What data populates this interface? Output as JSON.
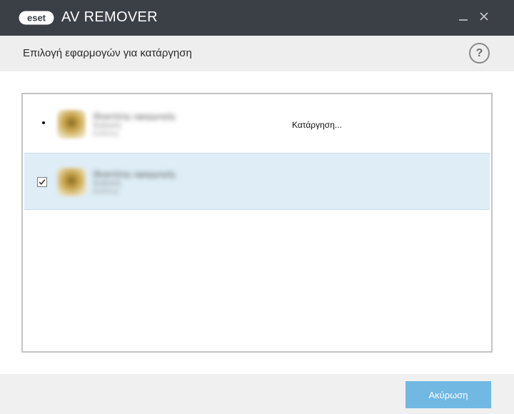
{
  "window": {
    "logo_text": "ESET",
    "app_title": "AV REMOVER",
    "minimize_glyph": "_",
    "close_glyph": "×",
    "colors": {
      "titlebar": "#3b3f46",
      "accent": "#71b8e3",
      "selected_row": "#deedf6"
    }
  },
  "header": {
    "title": "Επιλογή εφαρμογών για κατάργηση",
    "help_label": "?"
  },
  "list": {
    "items": [
      {
        "icon": "app-icon",
        "name": "Ιδιοκτήτης εφαρμογής",
        "version": "Έκδοση",
        "publisher": "Εκδότης",
        "status": "Κατάργηση...",
        "checked": false
      },
      {
        "icon": "app-icon",
        "name": "Ιδιοκτήτης εφαρμογής",
        "version": "Έκδοση",
        "publisher": "Εκδότης",
        "status": "",
        "checked": true
      }
    ]
  },
  "footer": {
    "cancel_label": "Ακύρωση"
  }
}
